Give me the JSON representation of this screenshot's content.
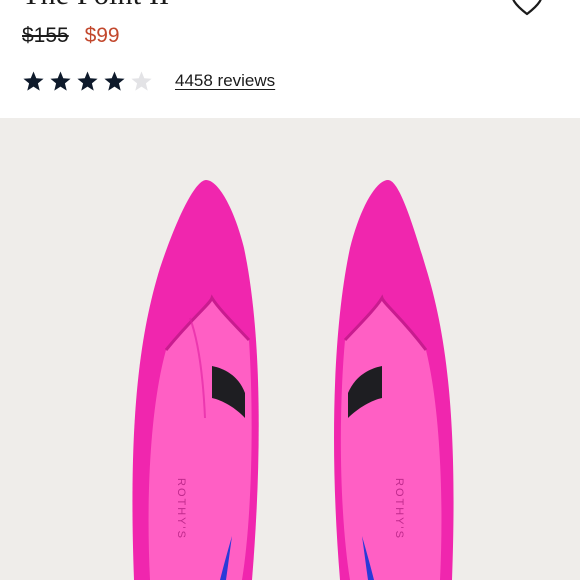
{
  "product": {
    "title": "The Point II",
    "original_price": "$155",
    "sale_price": "$99",
    "sale_color": "#c2482d"
  },
  "rating": {
    "stars_filled": 4,
    "stars_total": 5,
    "reviews_label": "4458 reviews"
  },
  "image": {
    "description_icon": "product-photo",
    "insole_brand": "ROTHY'S",
    "shoe_color": "#f026ae",
    "background_color": "#efedea"
  },
  "icons": {
    "wishlist": "heart-outline-icon",
    "star": "star-icon"
  }
}
